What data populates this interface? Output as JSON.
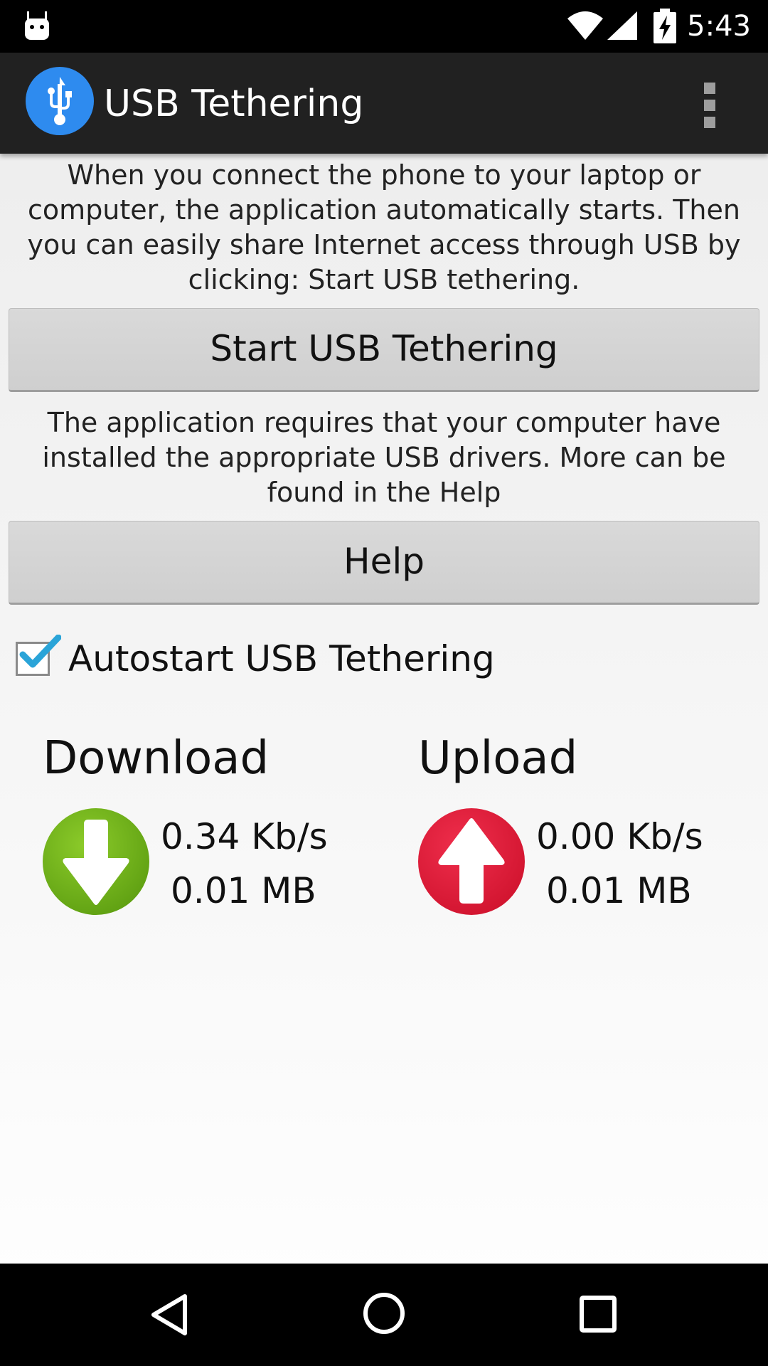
{
  "status_bar": {
    "time": "5:43",
    "icons": [
      "android-notification-icon",
      "wifi-icon",
      "signal-icon",
      "battery-charging-icon"
    ]
  },
  "app_bar": {
    "title": "USB Tethering",
    "app_icon": "usb-icon",
    "menu_icon": "overflow-menu-icon"
  },
  "main": {
    "intro_text": "When you connect the phone to your laptop or computer, the application automatically starts. Then you can easily share Internet access through USB by clicking: Start USB tethering.",
    "start_button_label": "Start USB Tethering",
    "drivers_text": "The application requires that your computer have installed the appropriate USB drivers. More can be found in the Help",
    "help_button_label": "Help",
    "autostart": {
      "label": "Autostart USB Tethering",
      "checked": true
    }
  },
  "stats": {
    "download": {
      "heading": "Download",
      "rate": "0.34 Kb/s",
      "total": "0.01 MB",
      "icon": "arrow-down-icon",
      "color": "#6fb01a"
    },
    "upload": {
      "heading": "Upload",
      "rate": "0.00 Kb/s",
      "total": "0.01 MB",
      "icon": "arrow-up-icon",
      "color": "#e21d3d"
    }
  },
  "nav_bar": {
    "icons": [
      "back-icon",
      "home-icon",
      "recents-icon"
    ]
  },
  "colors": {
    "app_bar": "#212121",
    "app_icon_bg": "#2e8bef",
    "checkmark": "#2aa4d8"
  }
}
